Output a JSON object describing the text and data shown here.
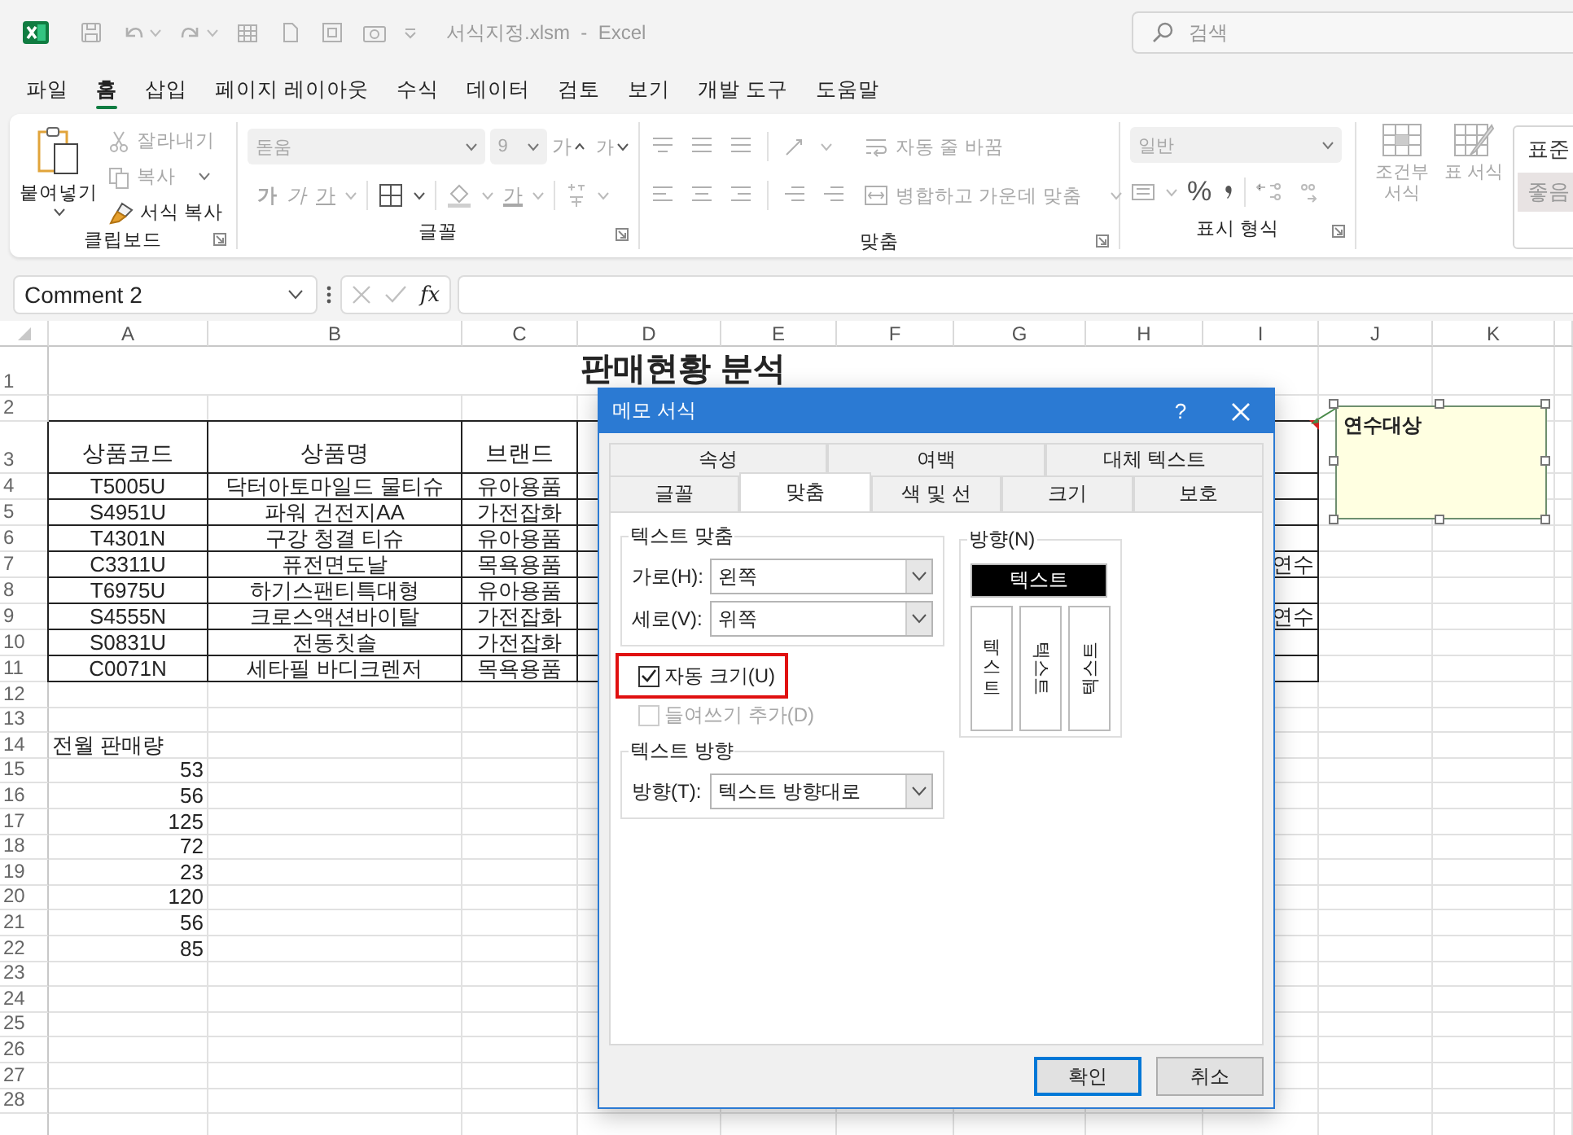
{
  "titlebar": {
    "title": "서식지정.xlsm  -  Excel"
  },
  "search": {
    "placeholder": "검색"
  },
  "menu_tabs": [
    {
      "label": "파일",
      "selected": false
    },
    {
      "label": "홈",
      "selected": true
    },
    {
      "label": "삽입",
      "selected": false
    },
    {
      "label": "페이지 레이아웃",
      "selected": false
    },
    {
      "label": "수식",
      "selected": false
    },
    {
      "label": "데이터",
      "selected": false
    },
    {
      "label": "검토",
      "selected": false
    },
    {
      "label": "보기",
      "selected": false
    },
    {
      "label": "개발 도구",
      "selected": false
    },
    {
      "label": "도움말",
      "selected": false
    }
  ],
  "ribbon": [
    {
      "kind": "clipboard",
      "label": "클립보드",
      "paste": "붙여넣기",
      "items": [
        {
          "kind": "cut",
          "label": "잘라내기",
          "disabled": true
        },
        {
          "kind": "copy",
          "label": "복사",
          "disabled": true
        },
        {
          "kind": "format-painter",
          "label": "서식 복사",
          "disabled": false
        }
      ]
    },
    {
      "kind": "font",
      "label": "글꼴",
      "disabled": true,
      "font": "돋움",
      "size": "9",
      "grow": "가",
      "shrink": "가",
      "bold": "가",
      "italic": "가",
      "underline": "가",
      "font_color": "가"
    },
    {
      "kind": "alignment",
      "label": "맞춤",
      "disabled": true,
      "wrap": "자동 줄 바꿈",
      "merge": "병합하고 가운데 맞춤"
    },
    {
      "kind": "number",
      "label": "표시 형식",
      "disabled": true,
      "format": "일반",
      "percent": "%"
    },
    {
      "kind": "styles",
      "disabled": true,
      "conditional": "조건부 서식",
      "table": "표 서식",
      "gallery": [
        {
          "kind": "normal",
          "label": "표준"
        },
        {
          "kind": "good",
          "label": "좋음"
        }
      ]
    }
  ],
  "formula_bar": {
    "name_box": "Comment 2",
    "function_label": "fx"
  },
  "sheet": {
    "columns": [
      "A",
      "B",
      "C",
      "D",
      "E",
      "F",
      "G",
      "H",
      "I",
      "J",
      "K"
    ],
    "rows": [
      {
        "number": "1",
        "kind": "title",
        "boxed": false,
        "title": "판매현황 분석"
      },
      {
        "number": "2",
        "kind": "empty",
        "boxed": false
      },
      {
        "number": "3",
        "kind": "header",
        "boxed": true,
        "cells": [
          "상품코드",
          "상품명",
          "브랜드"
        ]
      },
      {
        "number": "4",
        "kind": "data",
        "boxed": true,
        "cells": [
          "T5005U",
          "닥터아토마일드 물티슈",
          "유아용품"
        ]
      },
      {
        "number": "5",
        "kind": "data",
        "boxed": true,
        "cells": [
          "S4951U",
          "파워 건전지AA",
          "가전잡화"
        ]
      },
      {
        "number": "6",
        "kind": "data",
        "boxed": true,
        "cells": [
          "T4301N",
          "구강 청결 티슈",
          "유아용품"
        ]
      },
      {
        "number": "7",
        "kind": "data",
        "boxed": true,
        "cells": [
          "C3311U",
          "퓨전면도날",
          "목욕용품"
        ],
        "note": "연수"
      },
      {
        "number": "8",
        "kind": "data",
        "boxed": true,
        "cells": [
          "T6975U",
          "하기스팬티특대형",
          "유아용품"
        ]
      },
      {
        "number": "9",
        "kind": "data",
        "boxed": true,
        "cells": [
          "S4555N",
          "크로스액션바이탈",
          "가전잡화"
        ],
        "note": "연수"
      },
      {
        "number": "10",
        "kind": "data",
        "boxed": true,
        "cells": [
          "S0831U",
          "전동칫솔",
          "가전잡화"
        ]
      },
      {
        "number": "11",
        "kind": "data",
        "boxed": true,
        "cells": [
          "C0071N",
          "세타필 바디크렌저",
          "목욕용품"
        ]
      },
      {
        "number": "12",
        "kind": "empty",
        "boxed": false
      },
      {
        "number": "13",
        "kind": "empty",
        "boxed": false
      },
      {
        "number": "14",
        "kind": "label",
        "boxed": false,
        "cells": [
          "전월 판매량"
        ]
      },
      {
        "number": "15",
        "kind": "number",
        "boxed": false,
        "cells": [
          "53"
        ]
      },
      {
        "number": "16",
        "kind": "number",
        "boxed": false,
        "cells": [
          "56"
        ]
      },
      {
        "number": "17",
        "kind": "number",
        "boxed": false,
        "cells": [
          "125"
        ]
      },
      {
        "number": "18",
        "kind": "number",
        "boxed": false,
        "cells": [
          "72"
        ]
      },
      {
        "number": "19",
        "kind": "number",
        "boxed": false,
        "cells": [
          "23"
        ]
      },
      {
        "number": "20",
        "kind": "number",
        "boxed": false,
        "cells": [
          "120"
        ]
      },
      {
        "number": "21",
        "kind": "number",
        "boxed": false,
        "cells": [
          "56"
        ]
      },
      {
        "number": "22",
        "kind": "number",
        "boxed": false,
        "cells": [
          "85"
        ]
      },
      {
        "number": "23",
        "kind": "empty",
        "boxed": false
      },
      {
        "number": "24",
        "kind": "empty",
        "boxed": false
      },
      {
        "number": "25",
        "kind": "empty",
        "boxed": false
      },
      {
        "number": "26",
        "kind": "empty",
        "boxed": false
      },
      {
        "number": "27",
        "kind": "empty",
        "boxed": false
      },
      {
        "number": "28",
        "kind": "empty",
        "boxed": false
      }
    ]
  },
  "comment": {
    "text": "연수대상",
    "selected": true
  },
  "dialog": {
    "title": "메모 서식",
    "help": "?",
    "tab_rows": [
      [
        {
          "label": "속성",
          "selected": false
        },
        {
          "label": "여백",
          "selected": false
        },
        {
          "label": "대체 텍스트",
          "selected": false
        }
      ],
      [
        {
          "label": "글꼴",
          "selected": false
        },
        {
          "label": "맞춤",
          "selected": true
        },
        {
          "label": "색 및 선",
          "selected": false
        },
        {
          "label": "크기",
          "selected": false
        },
        {
          "label": "보호",
          "selected": false
        }
      ]
    ],
    "text_alignment": {
      "label": "텍스트 맞춤",
      "fields": [
        {
          "label": "가로(H):",
          "value": "왼쪽"
        },
        {
          "label": "세로(V):",
          "value": "위쪽"
        }
      ]
    },
    "checkboxes": [
      {
        "label": "자동 크기(U)",
        "checked": true,
        "highlighted": true,
        "disabled": false
      },
      {
        "label": "들여쓰기 추가(D)",
        "checked": false,
        "highlighted": false,
        "disabled": true
      }
    ],
    "text_direction": {
      "label": "텍스트 방향",
      "field": {
        "label": "방향(T):",
        "value": "텍스트 방향대로"
      }
    },
    "orientation": {
      "label": "방향(N)",
      "options": [
        {
          "kind": "horizontal",
          "label": "텍스트",
          "selected": true
        },
        {
          "kind": "stacked",
          "label": "텍스트",
          "selected": false
        },
        {
          "kind": "rotate-down",
          "label": "텍스트",
          "selected": false
        },
        {
          "kind": "rotate-up",
          "label": "텍스트",
          "selected": false
        }
      ]
    },
    "buttons": [
      {
        "label": "확인",
        "default": true
      },
      {
        "label": "취소",
        "default": false
      }
    ]
  }
}
